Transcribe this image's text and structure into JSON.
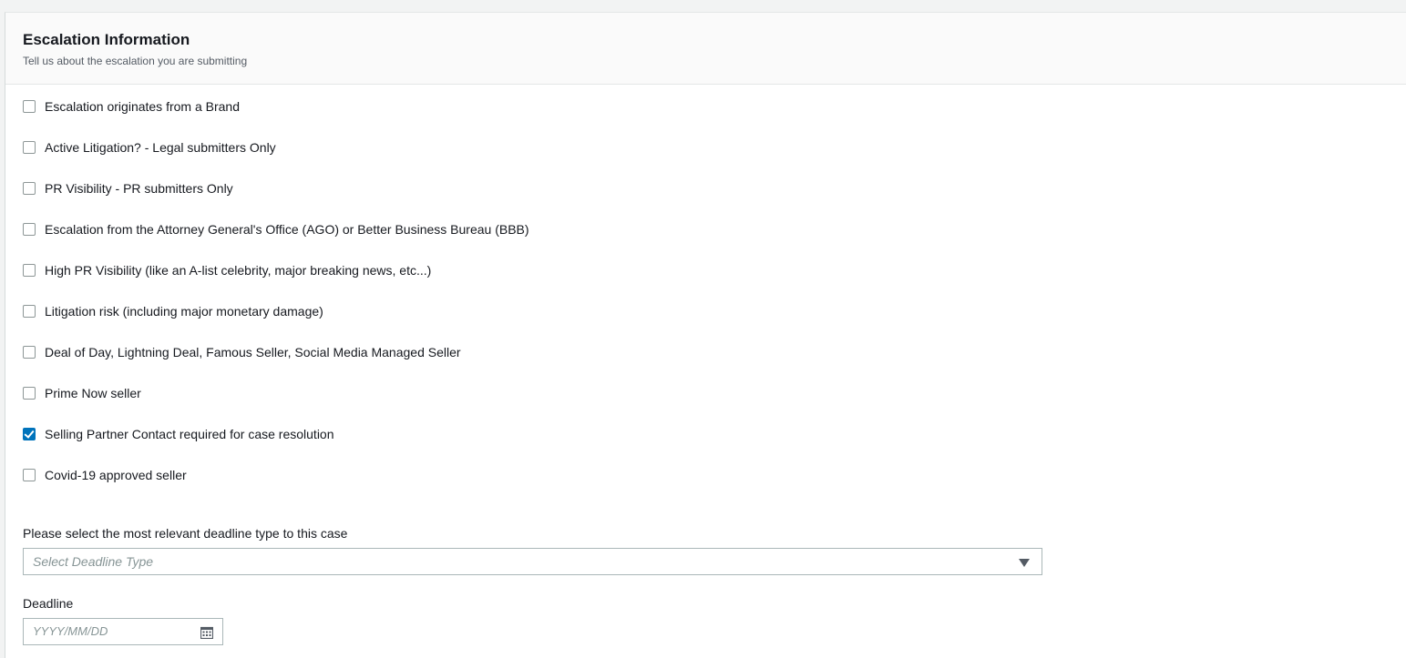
{
  "header": {
    "title": "Escalation Information",
    "subtitle": "Tell us about the escalation you are submitting"
  },
  "checkboxes": [
    {
      "label": "Escalation originates from a Brand",
      "checked": false
    },
    {
      "label": "Active Litigation? - Legal submitters Only",
      "checked": false
    },
    {
      "label": "PR Visibility - PR submitters Only",
      "checked": false
    },
    {
      "label": "Escalation from the Attorney General's Office (AGO) or Better Business Bureau (BBB)",
      "checked": false
    },
    {
      "label": "High PR Visibility (like an A-list celebrity, major breaking news, etc...)",
      "checked": false
    },
    {
      "label": "Litigation risk (including major monetary damage)",
      "checked": false
    },
    {
      "label": "Deal of Day, Lightning Deal, Famous Seller, Social Media Managed Seller",
      "checked": false
    },
    {
      "label": "Prime Now seller",
      "checked": false
    },
    {
      "label": "Selling Partner Contact required for case resolution",
      "checked": true
    },
    {
      "label": "Covid-19 approved seller",
      "checked": false
    }
  ],
  "deadline_type": {
    "label": "Please select the most relevant deadline type to this case",
    "placeholder": "Select Deadline Type",
    "icon": "chevron-down-icon"
  },
  "deadline": {
    "label": "Deadline",
    "placeholder": "YYYY/MM/DD",
    "icon": "calendar-icon"
  },
  "colors": {
    "accent": "#0073bb",
    "border": "#aab7b8",
    "placeholder": "#879596"
  }
}
